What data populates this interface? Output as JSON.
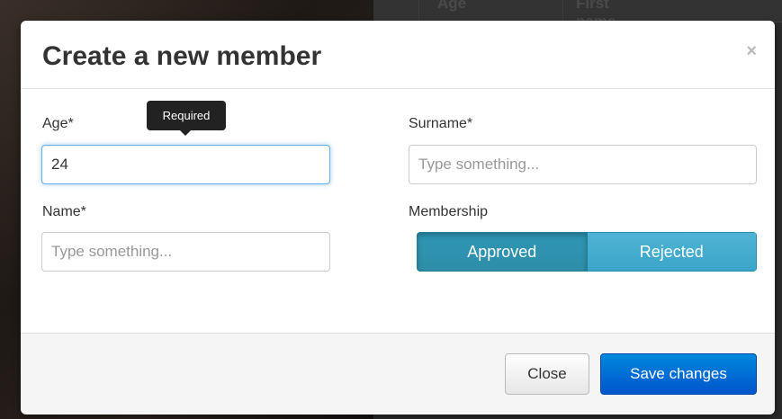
{
  "background": {
    "columns": [
      "Age",
      "First name"
    ]
  },
  "modal": {
    "title": "Create a new member",
    "close_icon": "×"
  },
  "form": {
    "age": {
      "label": "Age*",
      "value": "24",
      "tooltip": "Required"
    },
    "surname": {
      "label": "Surname*",
      "value": "",
      "placeholder": "Type something..."
    },
    "name": {
      "label": "Name*",
      "value": "",
      "placeholder": "Type something..."
    },
    "membership": {
      "label": "Membership",
      "options": [
        "Approved",
        "Rejected"
      ],
      "selected": "Approved"
    }
  },
  "footer": {
    "close_label": "Close",
    "save_label": "Save changes"
  },
  "colors": {
    "primary": "#0066cc",
    "info": "#2f96b4",
    "focus": "#66afe9"
  }
}
